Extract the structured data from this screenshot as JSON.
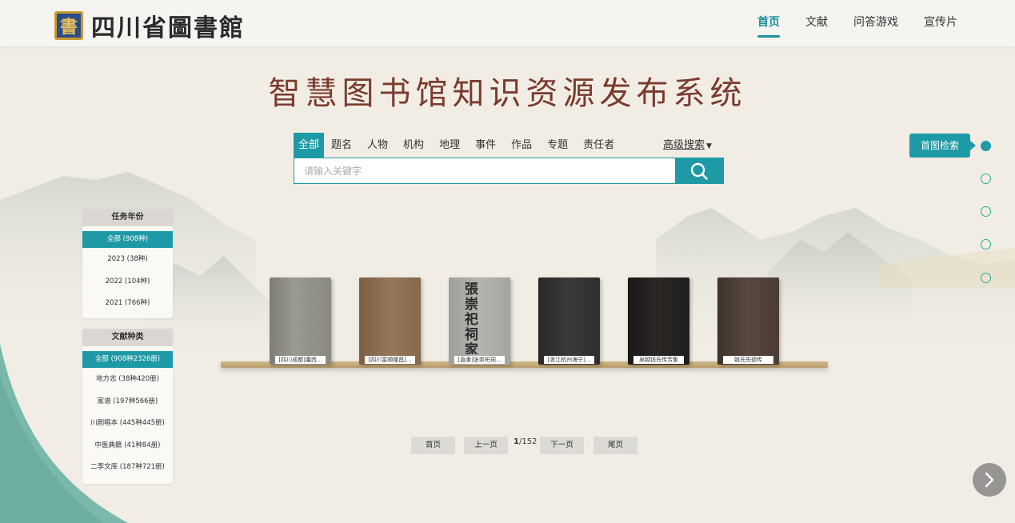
{
  "header": {
    "logo_seal": "書",
    "logo_text": "四川省圖書館",
    "nav": [
      {
        "label": "首页",
        "active": true
      },
      {
        "label": "文献",
        "active": false
      },
      {
        "label": "问答游戏",
        "active": false
      },
      {
        "label": "宣传片",
        "active": false
      }
    ]
  },
  "main": {
    "title": "智慧图书馆知识资源发布系统"
  },
  "search": {
    "tabs": [
      "全部",
      "题名",
      "人物",
      "机构",
      "地理",
      "事件",
      "作品",
      "专题",
      "责任者"
    ],
    "active_tab": 0,
    "advanced_label": "高级搜索",
    "placeholder": "请输入关键字",
    "value": "",
    "button_icon": "search-icon"
  },
  "filters": {
    "year": {
      "title": "任务年份",
      "items": [
        "全部 (908种)",
        "2023 (38种)",
        "2022 (104种)",
        "2021 (766种)"
      ],
      "active": 0
    },
    "type": {
      "title": "文献种类",
      "items": [
        "全部 (908种2326册)",
        "地方志 (38种420册)",
        "家谱 (197种566册)",
        "川剧唱本 (445种445册)",
        "中医典籍 (41种84册)",
        "二李文库 (187种721册)"
      ],
      "active": 0
    }
  },
  "books": [
    {
      "label": "[四川成都]庸西...",
      "cover": "#8c8c82"
    },
    {
      "label": "[四川富顺隆昌]...",
      "cover": "#8a6a4e"
    },
    {
      "label": "[直隶]张崇祀祠...",
      "cover": "#a8a9a4",
      "cover_text": "張崇祀祠家譜"
    },
    {
      "label": "[浙江杭州海宁]...",
      "cover": "#2e2e30"
    },
    {
      "label": "吴越钱氏传芳集",
      "cover": "#1f1d1c"
    },
    {
      "label": "姚氏先德传",
      "cover": "#4a3c34"
    }
  ],
  "pagination": {
    "first": "首页",
    "prev": "上一页",
    "current": "1",
    "total": "/152",
    "next": "下一页",
    "last": "尾页"
  },
  "side_nav": {
    "tag": "首图检索",
    "dots": 5,
    "active": 0
  },
  "colors": {
    "accent": "#1e9aa6",
    "title": "#7a3b2c",
    "background": "#f1ede5",
    "teal_decor": "#7ab8ab"
  }
}
